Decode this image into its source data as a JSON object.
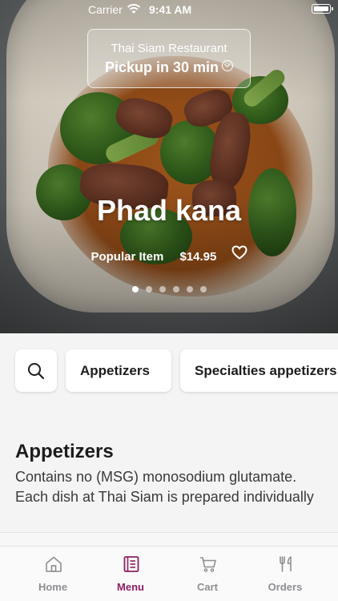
{
  "status_bar": {
    "carrier": "Carrier",
    "time": "9:41 AM"
  },
  "restaurant": {
    "name": "Thai Siam Restaurant",
    "pickup": "Pickup in 30 min"
  },
  "featured": {
    "name": "Phad kana",
    "badge": "Popular Item",
    "price": "$14.95",
    "carousel_pages": 6,
    "active_page": 1
  },
  "categories": [
    {
      "label": "Appetizers"
    },
    {
      "label": "Specialties appetizers"
    }
  ],
  "section": {
    "title": "Appetizers",
    "description": "Contains no (MSG) monosodium glutamate. Each dish at Thai Siam is prepared individually"
  },
  "tabs": [
    {
      "label": "Home",
      "icon": "home-icon"
    },
    {
      "label": "Menu",
      "icon": "menu-book-icon",
      "active": true
    },
    {
      "label": "Cart",
      "icon": "cart-icon"
    },
    {
      "label": "Orders",
      "icon": "fork-knife-icon"
    }
  ],
  "colors": {
    "accent": "#8e1f62",
    "tab_inactive": "#8e8e93",
    "background": "#f4f4f5"
  }
}
